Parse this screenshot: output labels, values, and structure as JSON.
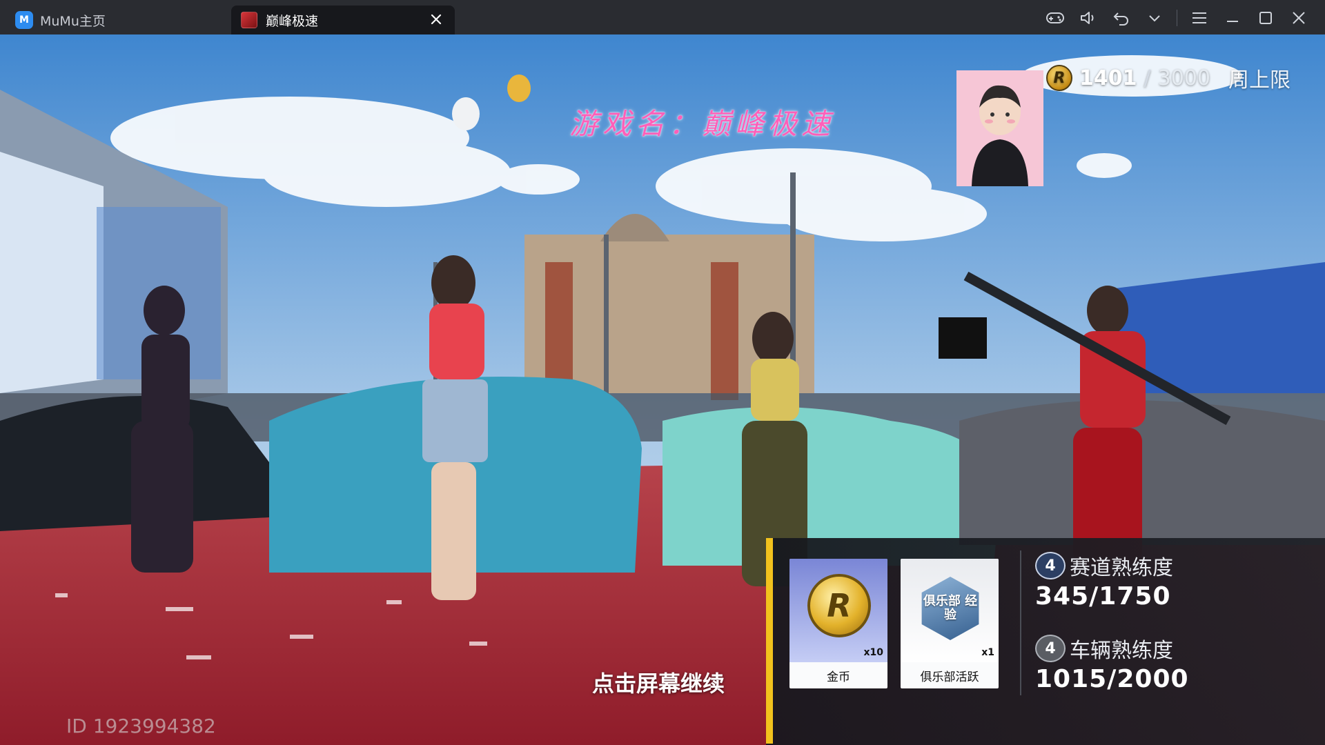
{
  "titlebar": {
    "home_tab": "MuMu主页",
    "game_tab": "巅峰极速",
    "icons": [
      "gamepad-icon",
      "volume-icon",
      "undo-icon",
      "chevron-down-icon",
      "menu-icon",
      "minimize-icon",
      "maximize-icon",
      "close-icon"
    ]
  },
  "overlay": {
    "game_title": "游戏名：巅峰极速",
    "coins": {
      "current": "1401",
      "separator": "/",
      "max": "3000",
      "label": "周上限"
    },
    "continue_hint": "点击屏幕继续",
    "player_id": "ID 1923994382"
  },
  "rewards": {
    "items": [
      {
        "label": "金币",
        "qty": "x10"
      },
      {
        "label": "俱乐部活跃",
        "qty": "x1",
        "badge_text": "俱乐部 经验"
      }
    ],
    "track": {
      "level": "4",
      "label": "赛道熟练度",
      "value": "345/1750"
    },
    "car": {
      "level": "4",
      "label": "车辆熟练度",
      "value": "1015/2000"
    }
  },
  "colors": {
    "accent": "#f2c21d",
    "title_pink": "#ff5fb8",
    "titlebar": "#2a2c31"
  }
}
